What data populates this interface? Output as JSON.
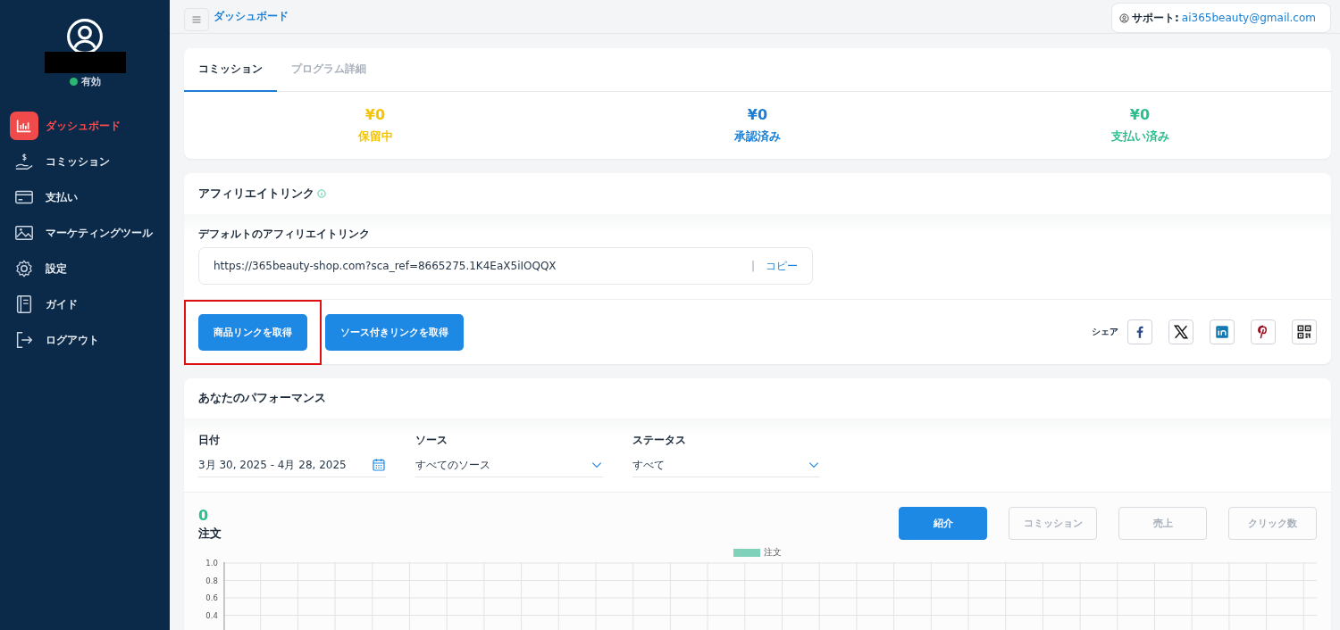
{
  "sidebar": {
    "status": {
      "label": "有効",
      "color": "#2bb673"
    },
    "items": [
      {
        "label": "ダッシュボード",
        "kind": "chart",
        "selected": true
      },
      {
        "label": "コミッション",
        "kind": "hand",
        "selected": false
      },
      {
        "label": "支払い",
        "kind": "card",
        "selected": false
      },
      {
        "label": "マーケティングツール",
        "kind": "image",
        "selected": false
      },
      {
        "label": "設定",
        "kind": "gear",
        "selected": false
      },
      {
        "label": "ガイド",
        "kind": "book",
        "selected": false
      },
      {
        "label": "ログアウト",
        "kind": "logout",
        "selected": false
      }
    ]
  },
  "topbar": {
    "title": "ダッシュボード",
    "support_label": "サポート:",
    "support_email": "ai365beauty@gmail.com"
  },
  "tabs": [
    {
      "label": "コミッション",
      "selected": true
    },
    {
      "label": "プログラム詳細",
      "selected": false
    }
  ],
  "stats": [
    {
      "value": "¥0",
      "label": "保留中",
      "color": "#f5c400"
    },
    {
      "value": "¥0",
      "label": "承認済み",
      "color": "#1a7fd4"
    },
    {
      "value": "¥0",
      "label": "支払い済み",
      "color": "#2bbf8e"
    }
  ],
  "affiliate": {
    "title": "アフィリエイトリンク",
    "field_label": "デフォルトのアフィリエイトリンク",
    "link": "https://365beauty-shop.com?sca_ref=8665275.1K4EaX5iIOQQX",
    "separator": "|",
    "copy": "コピー",
    "buttons": [
      {
        "label": "商品リンクを取得",
        "highlighted": true
      },
      {
        "label": "ソース付きリンクを取得",
        "highlighted": false
      }
    ],
    "share_label": "シェア",
    "share": [
      {
        "kind": "facebook"
      },
      {
        "kind": "x"
      },
      {
        "kind": "linkedin"
      },
      {
        "kind": "pinterest"
      },
      {
        "kind": "qr"
      }
    ]
  },
  "performance": {
    "title": "あなたのパフォーマンス",
    "filters": [
      {
        "kind": "date",
        "label": "日付",
        "value": "3月 30, 2025 - 4月 28, 2025"
      },
      {
        "kind": "select",
        "label": "ソース",
        "value": "すべてのソース"
      },
      {
        "kind": "select",
        "label": "ステータス",
        "value": "すべて"
      }
    ],
    "total": "0",
    "total_label": "注文",
    "metrics": [
      {
        "label": "紹介",
        "selected": true
      },
      {
        "label": "コミッション",
        "selected": false
      },
      {
        "label": "売上",
        "selected": false
      },
      {
        "label": "クリック数",
        "selected": false
      }
    ],
    "chart_data": {
      "type": "bar",
      "grid": true,
      "ylim": [
        0,
        1.0
      ],
      "yticks": [
        {
          "value": 1.0,
          "label": "1.0"
        },
        {
          "value": 0.8,
          "label": "0.8"
        },
        {
          "value": 0.6,
          "label": "0.6"
        },
        {
          "value": 0.4,
          "label": "0.4"
        }
      ],
      "series": [
        {
          "name": "注文",
          "color": "#7fd1b9"
        }
      ]
    }
  }
}
